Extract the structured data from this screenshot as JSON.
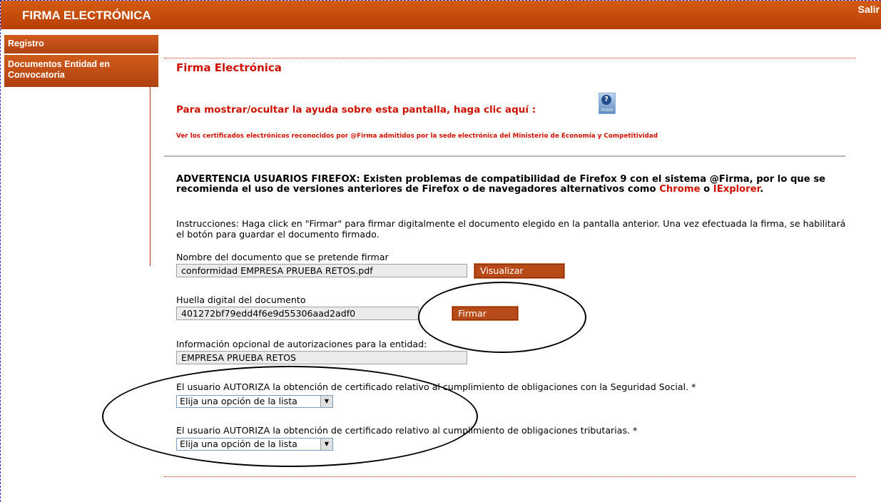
{
  "header": {
    "title": "FIRMA ELECTRÓNICA",
    "logout_label": "Salir"
  },
  "sidebar": {
    "items": [
      {
        "label": "Registro"
      },
      {
        "label": "Documentos Entidad en Convocatoria"
      }
    ]
  },
  "main": {
    "title": "Firma Electrónica",
    "help_prompt": "Para mostrar/ocultar la ayuda sobre esta pantalla, haga clic aquí   :",
    "help_icon_label": "AYUDA",
    "cert_link": "Ver los certificados electrónicos reconocidos por @Firma admitidos por la sede electrónica del Ministerio de Economía y Competitividad",
    "warning": {
      "text": "ADVERTENCIA USUARIOS FIREFOX: Existen problemas de compatibilidad de Firefox 9 con el sistema @Firma, por lo que se recomienda el uso de versiones anteriores de Firefox o de navegadores alternativos como ",
      "chrome": "Chrome",
      "or": " o ",
      "iexplorer": "IExplorer",
      "end": "."
    },
    "instructions": "Instrucciones: Haga click en \"Firmar\" para firmar digitalmente el documento elegido en la pantalla anterior. Una vez efectuada la firma, se habilitará el botón para guardar el documento firmado.",
    "doc_name_label": "Nombre del documento que se pretende firmar",
    "doc_name_value": "conformidad EMPRESA PRUEBA RETOS.pdf",
    "view_button": "Visualizar",
    "hash_label": "Huella digital del documento",
    "hash_value": "401272bf79edd4f6e9d55306aad2adf0",
    "sign_button": "Firmar",
    "auth_info_label": "Información opcional de autorizaciones para la entidad:",
    "auth_info_value": "EMPRESA PRUEBA RETOS",
    "ss_label": "El usuario AUTORIZA la obtención de certificado relativo al cumplimiento de obligaciones con la Seguridad Social. *",
    "ss_select": "Elija una opción de la lista",
    "tax_label": "El usuario AUTORIZA la obtención de certificado relativo al cumplimiento de obligaciones tributarias. *",
    "tax_select": "Elija una opción de la lista"
  }
}
